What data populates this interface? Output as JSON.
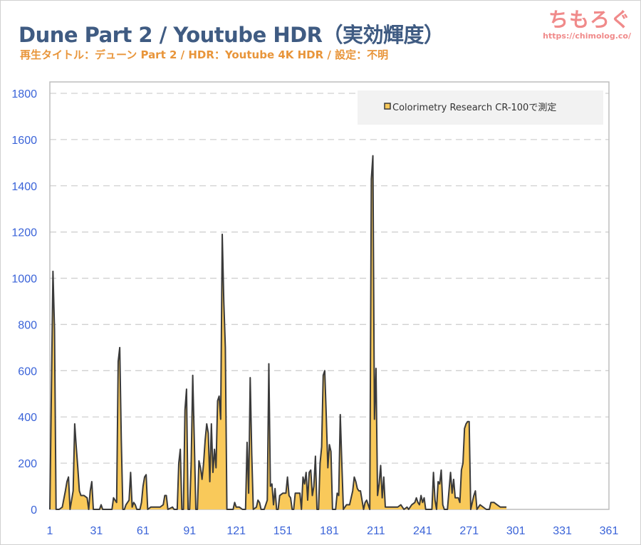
{
  "header": {
    "title": "Dune Part 2 / Youtube HDR（実効輝度）",
    "subtitle": "再生タイトル：デューン Part 2 / HDR：Youtube 4K HDR / 設定：不明"
  },
  "logo": {
    "name": "ちもろぐ",
    "url": "https://chimolog.co/"
  },
  "colors": {
    "fill": "#f9c95a",
    "line": "#3a3a3a",
    "tick": "#3a63d8",
    "grid": "#d0d0d0"
  },
  "chart_data": {
    "type": "area",
    "title": "",
    "xlabel": "",
    "ylabel": "",
    "xlim": [
      1,
      361
    ],
    "ylim": [
      0,
      1800
    ],
    "x_ticks": [
      1,
      31,
      61,
      91,
      121,
      151,
      181,
      211,
      241,
      271,
      301,
      331,
      361
    ],
    "y_ticks": [
      0,
      200,
      400,
      600,
      800,
      1000,
      1200,
      1400,
      1600,
      1800
    ],
    "grid": "horizontal-dashed",
    "legend_position": "top-right",
    "series": [
      {
        "name": "Colorimetry Research CR-100で測定",
        "points": [
          [
            1,
            0
          ],
          [
            3,
            1030
          ],
          [
            4,
            780
          ],
          [
            5,
            0
          ],
          [
            7,
            0
          ],
          [
            9,
            10
          ],
          [
            11,
            80
          ],
          [
            12,
            120
          ],
          [
            13,
            140
          ],
          [
            14,
            0
          ],
          [
            16,
            80
          ],
          [
            17,
            370
          ],
          [
            18,
            270
          ],
          [
            19,
            180
          ],
          [
            20,
            80
          ],
          [
            21,
            60
          ],
          [
            23,
            60
          ],
          [
            25,
            50
          ],
          [
            26,
            0
          ],
          [
            27,
            80
          ],
          [
            28,
            120
          ],
          [
            29,
            0
          ],
          [
            31,
            0
          ],
          [
            33,
            0
          ],
          [
            34,
            20
          ],
          [
            35,
            0
          ],
          [
            37,
            0
          ],
          [
            39,
            0
          ],
          [
            41,
            0
          ],
          [
            42,
            50
          ],
          [
            43,
            40
          ],
          [
            44,
            30
          ],
          [
            45,
            640
          ],
          [
            46,
            700
          ],
          [
            47,
            300
          ],
          [
            48,
            0
          ],
          [
            49,
            0
          ],
          [
            50,
            20
          ],
          [
            51,
            30
          ],
          [
            52,
            40
          ],
          [
            53,
            160
          ],
          [
            54,
            10
          ],
          [
            55,
            30
          ],
          [
            56,
            20
          ],
          [
            57,
            0
          ],
          [
            59,
            0
          ],
          [
            60,
            30
          ],
          [
            61,
            100
          ],
          [
            62,
            140
          ],
          [
            63,
            150
          ],
          [
            64,
            0
          ],
          [
            66,
            10
          ],
          [
            68,
            10
          ],
          [
            70,
            10
          ],
          [
            72,
            10
          ],
          [
            74,
            20
          ],
          [
            75,
            60
          ],
          [
            76,
            60
          ],
          [
            77,
            0
          ],
          [
            80,
            10
          ],
          [
            81,
            0
          ],
          [
            83,
            0
          ],
          [
            84,
            200
          ],
          [
            85,
            260
          ],
          [
            86,
            0
          ],
          [
            87,
            0
          ],
          [
            88,
            430
          ],
          [
            89,
            520
          ],
          [
            90,
            0
          ],
          [
            91,
            0
          ],
          [
            92,
            200
          ],
          [
            93,
            580
          ],
          [
            94,
            300
          ],
          [
            95,
            0
          ],
          [
            96,
            0
          ],
          [
            97,
            210
          ],
          [
            98,
            180
          ],
          [
            99,
            130
          ],
          [
            100,
            200
          ],
          [
            101,
            300
          ],
          [
            102,
            370
          ],
          [
            103,
            330
          ],
          [
            104,
            120
          ],
          [
            105,
            370
          ],
          [
            106,
            160
          ],
          [
            107,
            260
          ],
          [
            108,
            180
          ],
          [
            109,
            470
          ],
          [
            110,
            490
          ],
          [
            111,
            390
          ],
          [
            112,
            1190
          ],
          [
            113,
            900
          ],
          [
            114,
            700
          ],
          [
            115,
            0
          ],
          [
            117,
            0
          ],
          [
            119,
            0
          ],
          [
            120,
            30
          ],
          [
            121,
            10
          ],
          [
            123,
            10
          ],
          [
            125,
            0
          ],
          [
            127,
            0
          ],
          [
            128,
            290
          ],
          [
            129,
            70
          ],
          [
            130,
            570
          ],
          [
            131,
            240
          ],
          [
            132,
            0
          ],
          [
            134,
            10
          ],
          [
            135,
            40
          ],
          [
            136,
            30
          ],
          [
            137,
            0
          ],
          [
            139,
            0
          ],
          [
            141,
            40
          ],
          [
            142,
            630
          ],
          [
            143,
            100
          ],
          [
            144,
            110
          ],
          [
            145,
            20
          ],
          [
            146,
            90
          ],
          [
            147,
            0
          ],
          [
            148,
            0
          ],
          [
            149,
            60
          ],
          [
            151,
            70
          ],
          [
            153,
            70
          ],
          [
            154,
            140
          ],
          [
            155,
            60
          ],
          [
            156,
            50
          ],
          [
            157,
            0
          ],
          [
            158,
            0
          ],
          [
            159,
            70
          ],
          [
            161,
            70
          ],
          [
            162,
            70
          ],
          [
            163,
            0
          ],
          [
            164,
            140
          ],
          [
            165,
            110
          ],
          [
            166,
            160
          ],
          [
            167,
            40
          ],
          [
            168,
            160
          ],
          [
            169,
            170
          ],
          [
            170,
            60
          ],
          [
            171,
            100
          ],
          [
            172,
            230
          ],
          [
            173,
            0
          ],
          [
            174,
            0
          ],
          [
            175,
            200
          ],
          [
            176,
            270
          ],
          [
            177,
            580
          ],
          [
            178,
            600
          ],
          [
            179,
            400
          ],
          [
            180,
            180
          ],
          [
            181,
            280
          ],
          [
            182,
            250
          ],
          [
            183,
            0
          ],
          [
            185,
            0
          ],
          [
            186,
            70
          ],
          [
            187,
            60
          ],
          [
            188,
            410
          ],
          [
            189,
            200
          ],
          [
            190,
            0
          ],
          [
            192,
            20
          ],
          [
            194,
            20
          ],
          [
            195,
            50
          ],
          [
            196,
            80
          ],
          [
            197,
            140
          ],
          [
            198,
            120
          ],
          [
            199,
            90
          ],
          [
            200,
            80
          ],
          [
            201,
            80
          ],
          [
            202,
            40
          ],
          [
            203,
            0
          ],
          [
            204,
            30
          ],
          [
            205,
            40
          ],
          [
            206,
            20
          ],
          [
            207,
            0
          ],
          [
            208,
            1430
          ],
          [
            209,
            1530
          ],
          [
            210,
            390
          ],
          [
            211,
            610
          ],
          [
            212,
            60
          ],
          [
            213,
            110
          ],
          [
            214,
            190
          ],
          [
            215,
            50
          ],
          [
            216,
            140
          ],
          [
            217,
            10
          ],
          [
            219,
            10
          ],
          [
            221,
            10
          ],
          [
            223,
            10
          ],
          [
            225,
            10
          ],
          [
            227,
            20
          ],
          [
            229,
            0
          ],
          [
            231,
            10
          ],
          [
            232,
            0
          ],
          [
            234,
            20
          ],
          [
            236,
            30
          ],
          [
            237,
            50
          ],
          [
            238,
            30
          ],
          [
            239,
            20
          ],
          [
            240,
            60
          ],
          [
            241,
            30
          ],
          [
            242,
            50
          ],
          [
            243,
            0
          ],
          [
            245,
            0
          ],
          [
            247,
            0
          ],
          [
            248,
            160
          ],
          [
            249,
            40
          ],
          [
            250,
            0
          ],
          [
            251,
            120
          ],
          [
            252,
            110
          ],
          [
            253,
            170
          ],
          [
            254,
            20
          ],
          [
            255,
            0
          ],
          [
            257,
            0
          ],
          [
            259,
            160
          ],
          [
            260,
            70
          ],
          [
            261,
            130
          ],
          [
            262,
            50
          ],
          [
            263,
            50
          ],
          [
            264,
            50
          ],
          [
            265,
            30
          ],
          [
            266,
            170
          ],
          [
            267,
            200
          ],
          [
            268,
            350
          ],
          [
            269,
            370
          ],
          [
            270,
            380
          ],
          [
            271,
            380
          ],
          [
            272,
            0
          ],
          [
            274,
            60
          ],
          [
            275,
            80
          ],
          [
            276,
            0
          ],
          [
            278,
            20
          ],
          [
            280,
            10
          ],
          [
            282,
            0
          ],
          [
            284,
            0
          ],
          [
            285,
            30
          ],
          [
            287,
            30
          ],
          [
            289,
            20
          ],
          [
            291,
            10
          ],
          [
            293,
            10
          ],
          [
            295,
            10
          ]
        ]
      }
    ]
  }
}
